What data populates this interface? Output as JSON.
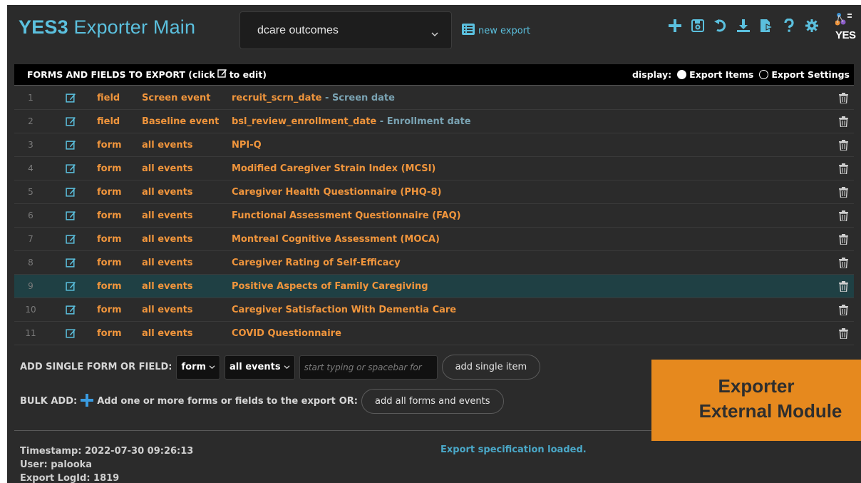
{
  "header": {
    "title_bold": "YES3",
    "title_rest": " Exporter Main",
    "selected_export": "dcare outcomes",
    "new_export_label": "new export",
    "logo_text": "YES"
  },
  "table": {
    "heading": "FORMS AND FIELDS TO EXPORT (click",
    "heading_tail": "to edit)",
    "display_label": "display:",
    "display_options": [
      "Export Items",
      "Export Settings"
    ],
    "display_selected": "Export Items",
    "rows": [
      {
        "num": "1",
        "type": "field",
        "event": "Screen event",
        "name": "recruit_scrn_date",
        "label": " - Screen date"
      },
      {
        "num": "2",
        "type": "field",
        "event": "Baseline event",
        "name": "bsl_review_enrollment_date",
        "label": " - Enrollment date"
      },
      {
        "num": "3",
        "type": "form",
        "event": "all events",
        "name": "NPI-Q",
        "label": ""
      },
      {
        "num": "4",
        "type": "form",
        "event": "all events",
        "name": "Modified Caregiver Strain Index (MCSI)",
        "label": ""
      },
      {
        "num": "5",
        "type": "form",
        "event": "all events",
        "name": "Caregiver Health Questionnaire (PHQ-8)",
        "label": ""
      },
      {
        "num": "6",
        "type": "form",
        "event": "all events",
        "name": "Functional Assessment Questionnaire (FAQ)",
        "label": ""
      },
      {
        "num": "7",
        "type": "form",
        "event": "all events",
        "name": "Montreal Cognitive Assessment (MOCA)",
        "label": ""
      },
      {
        "num": "8",
        "type": "form",
        "event": "all events",
        "name": "Caregiver Rating of Self-Efficacy",
        "label": ""
      },
      {
        "num": "9",
        "type": "form",
        "event": "all events",
        "name": "Positive Aspects of Family Caregiving",
        "label": ""
      },
      {
        "num": "10",
        "type": "form",
        "event": "all events",
        "name": "Caregiver Satisfaction With Dementia Care",
        "label": ""
      },
      {
        "num": "11",
        "type": "form",
        "event": "all events",
        "name": "COVID Questionnaire",
        "label": ""
      }
    ],
    "highlighted_row": 9
  },
  "add": {
    "single_label": "ADD SINGLE FORM OR FIELD:",
    "type_value": "form",
    "event_value": "all events",
    "search_placeholder": "start typing or spacebar for",
    "add_single_button": "add single item",
    "bulk_label": "BULK ADD:",
    "bulk_text": "Add one or more forms or fields to the export",
    "or_text": "OR:",
    "add_all_button": "add all forms and events"
  },
  "footer": {
    "timestamp": "Timestamp: 2022-07-30 09:26:13",
    "user": "User: palooka",
    "log_id": "Export LogId: 1819",
    "status": "Export specification loaded."
  },
  "badge": {
    "line1": "Exporter",
    "line2": "External Module"
  },
  "colors": {
    "accent_blue": "#5bc0de",
    "orange": "#f0953c",
    "badge_orange": "#e6891e",
    "background": "#2b2b2b",
    "highlight_row": "#1f4044"
  }
}
